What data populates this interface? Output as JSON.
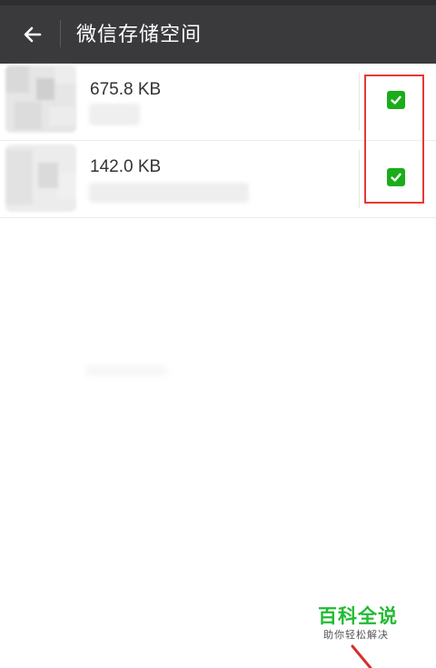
{
  "header": {
    "title": "微信存储空间",
    "back_icon": "back-arrow-icon"
  },
  "items": [
    {
      "size": "675.8 KB",
      "checked": true
    },
    {
      "size": "142.0 KB",
      "checked": true
    }
  ],
  "watermark": {
    "title": "百科全说",
    "subtitle": "助你轻松解决"
  },
  "colors": {
    "header_bg": "#3a3a3c",
    "check_green": "#1aad19",
    "highlight_red": "#e53935",
    "watermark_green": "#22bb33"
  }
}
